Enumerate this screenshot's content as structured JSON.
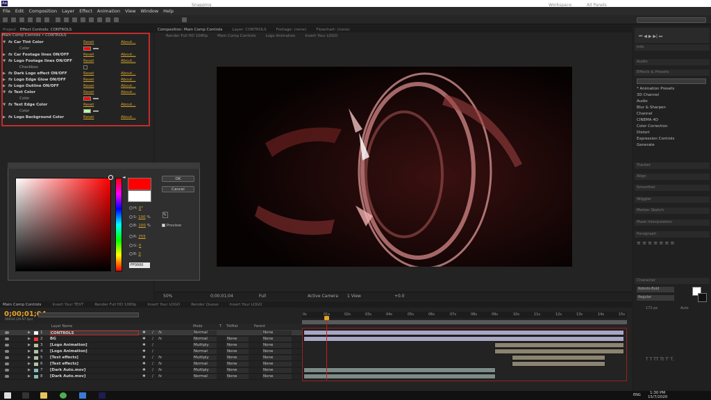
{
  "app": {
    "icon_text": "Ae"
  },
  "menu": [
    "File",
    "Edit",
    "Composition",
    "Layer",
    "Effect",
    "Animation",
    "View",
    "Window",
    "Help"
  ],
  "toolbar": {
    "snapping": "Snapping",
    "workspace_label": "Workspace:",
    "workspace_value": "All Panels"
  },
  "project_tabs": [
    "Project",
    "Effect Controls: CONTROLS"
  ],
  "effect_controls": {
    "header": "Main Comp Controls • CONTROLS",
    "effects": [
      {
        "name": "Car Tint Color",
        "reset": "Reset",
        "about": "About..."
      },
      {
        "sub": "Color",
        "swatch": "#ff0000"
      },
      {
        "name": "Car Footage lines ON/OFF",
        "reset": "Reset",
        "about": "About..."
      },
      {
        "name": "Logo Footage lines ON/OFF",
        "reset": "Reset",
        "about": "About..."
      },
      {
        "sub": "Checkbox"
      },
      {
        "name": "Dark Logo effect ON/OFF",
        "reset": "Reset",
        "about": "About..."
      },
      {
        "name": "Logo Edge Glow ON/OFF",
        "reset": "Reset",
        "about": "About..."
      },
      {
        "name": "Logo Outline ON/OFF",
        "reset": "Reset",
        "about": "About..."
      },
      {
        "name": "Text Color",
        "reset": "Reset",
        "about": "About..."
      },
      {
        "sub": "Color",
        "swatch": "#ff0000"
      },
      {
        "name": "Text Edge Color",
        "reset": "Reset",
        "about": "About..."
      },
      {
        "sub": "Color",
        "swatch": "#b8ffa8"
      },
      {
        "name": "Logo Background Color",
        "reset": "Reset",
        "about": "About..."
      }
    ]
  },
  "comp_tabs": [
    "Composition: Main Comp Controls",
    "Layer: CONTROLS",
    "Footage: (none)",
    "Flowchart: (none)"
  ],
  "comp_breadcrumbs": [
    "Render Full HD 1080p",
    "Main Comp Controls",
    "Logo Animation",
    "Insert Your LOGO"
  ],
  "comp_footer": {
    "zoom": "50%",
    "time": "0;00;01;04",
    "quality": "Full",
    "camera": "Active Camera",
    "views": "1 View",
    "offset": "+0.0"
  },
  "color_picker": {
    "ok": "OK",
    "cancel": "Cancel",
    "h": {
      "label": "H:",
      "value": "0",
      "unit": "°"
    },
    "s": {
      "label": "S:",
      "value": "100",
      "unit": "%"
    },
    "b": {
      "label": "B:",
      "value": "100",
      "unit": "%"
    },
    "r": {
      "label": "R:",
      "value": "255"
    },
    "g": {
      "label": "G:",
      "value": "0"
    },
    "bl": {
      "label": "B:",
      "value": "0"
    },
    "hex": "FF0000",
    "preview": "Preview",
    "new_color": "#ff0000",
    "current_color": "#ffffff"
  },
  "right_panels": {
    "headers": [
      "Info",
      "Audio",
      "Effects & Presets",
      "Tracker",
      "Align",
      "Smoother",
      "Wiggler",
      "Motion Sketch",
      "Mask Interpolation",
      "Paragraph",
      "Character"
    ],
    "effects_list": [
      "* Animation Presets",
      "3D Channel",
      "Audio",
      "Blur & Sharpen",
      "Channel",
      "CINEMA 4D",
      "Color Correction",
      "Distort",
      "Expression Controls",
      "Generate"
    ],
    "font_name": "Roboto-Bold",
    "font_style": "Regular",
    "font_size": "172 px",
    "leading": "Auto"
  },
  "timeline": {
    "tabs": [
      "Main Comp Controls",
      "Insert Your TEXT",
      "Render Full HD 1080p",
      "Insert Your LOGO",
      "Render Queue",
      "Insert Your LOGO"
    ],
    "time": "0;00;01;04",
    "fps": "00034 (29.97 fps)",
    "col_layer": "Layer Name",
    "col_mode": "Mode",
    "col_t": "T",
    "col_trkmat": "TrkMat",
    "col_parent": "Parent",
    "ticks": [
      "0s",
      "01s",
      "02s",
      "03s",
      "04s",
      "05s",
      "06s",
      "07s",
      "08s",
      "09s",
      "10s",
      "11s",
      "12s",
      "13s",
      "14s",
      "15s"
    ],
    "layers": [
      {
        "num": "1",
        "name": "CONTROLS",
        "mode": "Normal",
        "trk": "",
        "parent": "None",
        "color": "#ffffff",
        "bar": "#a8a6c4"
      },
      {
        "num": "2",
        "name": "BG",
        "mode": "Normal",
        "trk": "None",
        "parent": "None",
        "color": "#ff3333",
        "bar": "#a8a6c4"
      },
      {
        "num": "3",
        "name": "[Logo Animation]",
        "mode": "Multiply",
        "trk": "None",
        "parent": "None",
        "color": "#b0c4a8",
        "bar": "#8c8470"
      },
      {
        "num": "4",
        "name": "[Logo Animation]",
        "mode": "Normal",
        "trk": "None",
        "parent": "None",
        "color": "#b0c4a8",
        "bar": "#8c8470"
      },
      {
        "num": "5",
        "name": "[Text effects]",
        "mode": "Multiply",
        "trk": "None",
        "parent": "None",
        "color": "#b0c4a8",
        "bar": "#8c8470"
      },
      {
        "num": "6",
        "name": "[Text effects]",
        "mode": "Normal",
        "trk": "None",
        "parent": "None",
        "color": "#b0c4a8",
        "bar": "#8c8470"
      },
      {
        "num": "7",
        "name": "[Dark Auto.mov]",
        "mode": "Multiply",
        "trk": "None",
        "parent": "None",
        "color": "#88bcbc",
        "bar": "#7c8c88"
      },
      {
        "num": "8",
        "name": "[Dark Auto.mov]",
        "mode": "Normal",
        "trk": "None",
        "parent": "None",
        "color": "#88bcbc",
        "bar": "#7c8c88"
      }
    ]
  },
  "taskbar": {
    "time": "1:30 PM",
    "date": "15/7/2020",
    "lang": "ENG"
  }
}
